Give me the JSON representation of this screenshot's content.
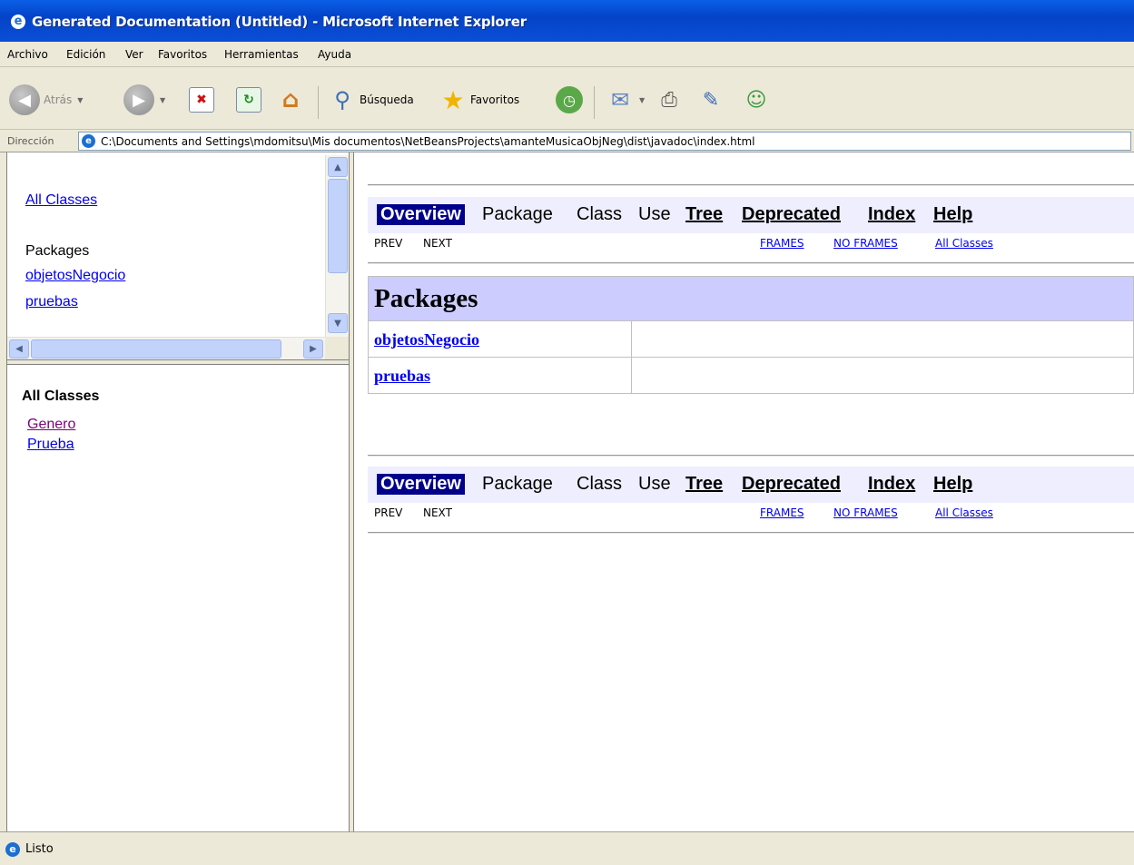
{
  "window": {
    "title": "Generated Documentation (Untitled) - Microsoft Internet Explorer"
  },
  "menu": [
    "Archivo",
    "Edición",
    "Ver",
    "Favoritos",
    "Herramientas",
    "Ayuda"
  ],
  "toolbar": {
    "back_label": "Atrás",
    "search_label": "Búsqueda",
    "favorites_label": "Favoritos"
  },
  "address": {
    "label": "Dirección",
    "url": "C:\\Documents and Settings\\mdomitsu\\Mis documentos\\NetBeansProjects\\amanteMusicaObjNeg\\dist\\javadoc\\index.html"
  },
  "package_frame": {
    "all_classes_link": "All Classes",
    "packages_heading": "Packages",
    "packages": [
      "objetosNegocio",
      "pruebas"
    ]
  },
  "class_frame": {
    "heading": "All Classes",
    "classes": [
      "Genero",
      "Prueba"
    ]
  },
  "main": {
    "nav": {
      "overview": "Overview",
      "package": "Package",
      "class": "Class",
      "use": "Use",
      "tree": "Tree",
      "deprecated": "Deprecated",
      "index": "Index",
      "help": "Help"
    },
    "subnav": {
      "prev": "PREV",
      "next": "NEXT",
      "frames": "FRAMES",
      "no_frames": "NO FRAMES",
      "all_classes": "All Classes"
    },
    "packages_title": "Packages",
    "packages": [
      "objetosNegocio",
      "pruebas"
    ]
  },
  "status": {
    "text": "Listo"
  }
}
